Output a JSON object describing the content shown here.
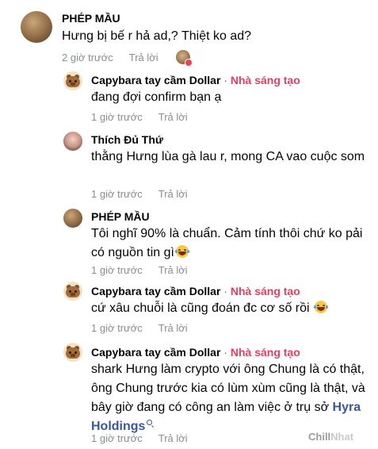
{
  "comments": [
    {
      "author": "PHÉP MẦU",
      "text": "Hưng bị bế r hả ad,? Thiệt ko ad?",
      "time": "2 giờ trước",
      "reply_label": "Trả lời",
      "reaction": "heart"
    },
    {
      "author": "Capybara tay cầm Dollar",
      "separator": "·",
      "badge": "Nhà sáng tạo",
      "text": "đang đợi confirm bạn ạ",
      "time": "1 giờ trước",
      "reply_label": "Trả lời"
    },
    {
      "author": "Thích Đủ Thứ",
      "text": "thằng Hưng lùa gà lau r, mong CA vao cuộc som",
      "time": "1 giờ trước",
      "reply_label": "Trả lời"
    },
    {
      "author": "PHÉP MẦU",
      "text": "Tôi nghĩ 90% là chuẩn. Cảm tính thôi chứ ko pải có nguồn tin gì",
      "emoji": "rolling-on-floor-laughing-emoji",
      "time": "1 giờ trước",
      "reply_label": "Trả lời"
    },
    {
      "author": "Capybara tay cầm Dollar",
      "separator": "·",
      "badge": "Nhà sáng tạo",
      "text": "cứ xâu chuỗi là cũng đoán đc cơ số rồi",
      "emoji": "rolling-on-floor-laughing-emoji",
      "time": "1 giờ trước",
      "reply_label": "Trả lời"
    },
    {
      "author": "Capybara tay cầm Dollar",
      "separator": "·",
      "badge": "Nhà sáng tạo",
      "text": "shark Hưng làm crypto với ông Chung là có thật, ông Chung trước kia có lùm xùm cũng là thật, và bây giờ đang có công an làm việc ở trụ sở",
      "link": "Hyra Holdings",
      "link_icon": "search-icon",
      "time": "1 giờ trước",
      "reply_label": "Trả lời"
    }
  ],
  "watermark": {
    "part1": "Chill",
    "part2": "Nhat"
  },
  "colors": {
    "creator_badge": "#e4405f",
    "link": "#385898",
    "meta": "#8a8d91"
  }
}
